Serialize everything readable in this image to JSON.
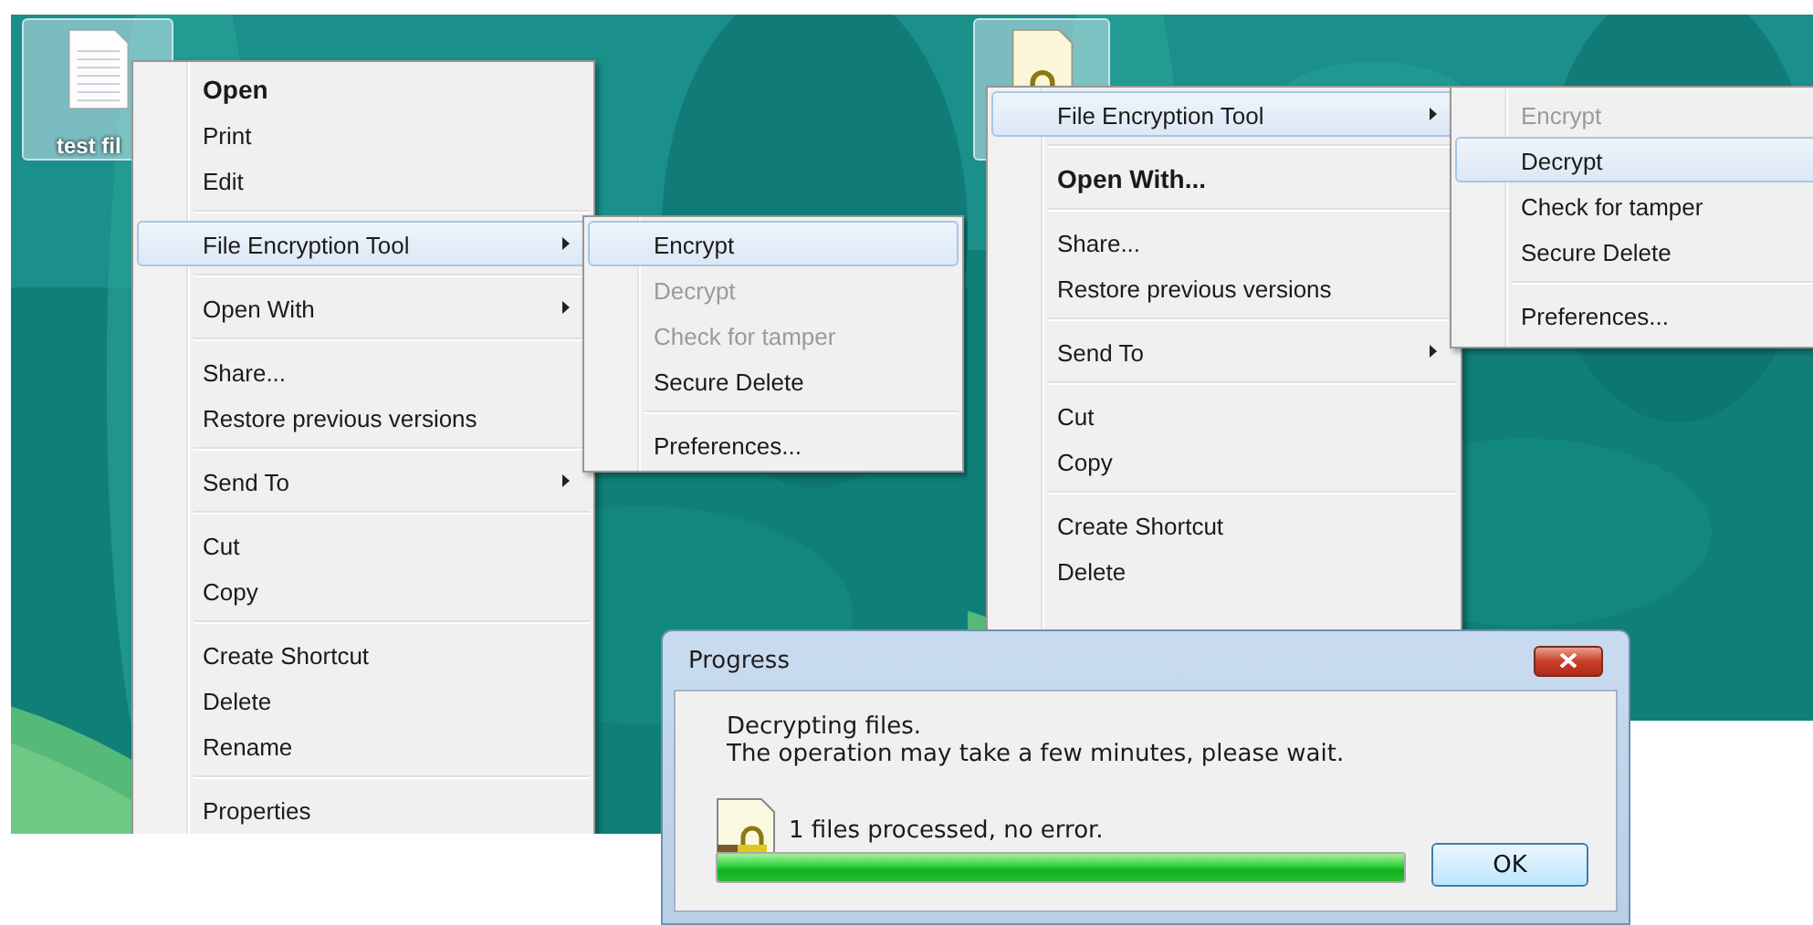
{
  "panels": [
    {
      "icon": {
        "kind": "document",
        "label": "test fil"
      },
      "menu": {
        "items": [
          {
            "kind": "item",
            "label": "Open",
            "bold": true,
            "selected": false,
            "disabled": false,
            "has_submenu": false
          },
          {
            "kind": "item",
            "label": "Print",
            "bold": false,
            "selected": false,
            "disabled": false,
            "has_submenu": false
          },
          {
            "kind": "item",
            "label": "Edit",
            "bold": false,
            "selected": false,
            "disabled": false,
            "has_submenu": false
          },
          {
            "kind": "separator"
          },
          {
            "kind": "item",
            "label": "File Encryption Tool",
            "bold": false,
            "selected": true,
            "disabled": false,
            "has_submenu": true
          },
          {
            "kind": "separator"
          },
          {
            "kind": "item",
            "label": "Open With",
            "bold": false,
            "selected": false,
            "disabled": false,
            "has_submenu": true
          },
          {
            "kind": "separator"
          },
          {
            "kind": "item",
            "label": "Share...",
            "bold": false,
            "selected": false,
            "disabled": false,
            "has_submenu": false
          },
          {
            "kind": "item",
            "label": "Restore previous versions",
            "bold": false,
            "selected": false,
            "disabled": false,
            "has_submenu": false
          },
          {
            "kind": "separator"
          },
          {
            "kind": "item",
            "label": "Send To",
            "bold": false,
            "selected": false,
            "disabled": false,
            "has_submenu": true
          },
          {
            "kind": "separator"
          },
          {
            "kind": "item",
            "label": "Cut",
            "bold": false,
            "selected": false,
            "disabled": false,
            "has_submenu": false
          },
          {
            "kind": "item",
            "label": "Copy",
            "bold": false,
            "selected": false,
            "disabled": false,
            "has_submenu": false
          },
          {
            "kind": "separator"
          },
          {
            "kind": "item",
            "label": "Create Shortcut",
            "bold": false,
            "selected": false,
            "disabled": false,
            "has_submenu": false
          },
          {
            "kind": "item",
            "label": "Delete",
            "bold": false,
            "selected": false,
            "disabled": false,
            "has_submenu": false
          },
          {
            "kind": "item",
            "label": "Rename",
            "bold": false,
            "selected": false,
            "disabled": false,
            "has_submenu": false
          },
          {
            "kind": "separator"
          },
          {
            "kind": "item",
            "label": "Properties",
            "bold": false,
            "selected": false,
            "disabled": false,
            "has_submenu": false
          }
        ]
      },
      "submenu": {
        "items": [
          {
            "kind": "item",
            "label": "Encrypt",
            "bold": false,
            "selected": true,
            "disabled": false,
            "has_submenu": false
          },
          {
            "kind": "item",
            "label": "Decrypt",
            "bold": false,
            "selected": false,
            "disabled": true,
            "has_submenu": false
          },
          {
            "kind": "item",
            "label": "Check for tamper",
            "bold": false,
            "selected": false,
            "disabled": true,
            "has_submenu": false
          },
          {
            "kind": "item",
            "label": "Secure Delete",
            "bold": false,
            "selected": false,
            "disabled": false,
            "has_submenu": false
          },
          {
            "kind": "separator"
          },
          {
            "kind": "item",
            "label": "Preferences...",
            "bold": false,
            "selected": false,
            "disabled": false,
            "has_submenu": false
          }
        ]
      }
    },
    {
      "icon": {
        "kind": "encrypted-document"
      },
      "menu": {
        "items": [
          {
            "kind": "item",
            "label": "File Encryption Tool",
            "bold": false,
            "selected": true,
            "disabled": false,
            "has_submenu": true
          },
          {
            "kind": "separator"
          },
          {
            "kind": "item",
            "label": "Open With...",
            "bold": true,
            "selected": false,
            "disabled": false,
            "has_submenu": false
          },
          {
            "kind": "separator"
          },
          {
            "kind": "item",
            "label": "Share...",
            "bold": false,
            "selected": false,
            "disabled": false,
            "has_submenu": false
          },
          {
            "kind": "item",
            "label": "Restore previous versions",
            "bold": false,
            "selected": false,
            "disabled": false,
            "has_submenu": false
          },
          {
            "kind": "separator"
          },
          {
            "kind": "item",
            "label": "Send To",
            "bold": false,
            "selected": false,
            "disabled": false,
            "has_submenu": true
          },
          {
            "kind": "separator"
          },
          {
            "kind": "item",
            "label": "Cut",
            "bold": false,
            "selected": false,
            "disabled": false,
            "has_submenu": false
          },
          {
            "kind": "item",
            "label": "Copy",
            "bold": false,
            "selected": false,
            "disabled": false,
            "has_submenu": false
          },
          {
            "kind": "separator"
          },
          {
            "kind": "item",
            "label": "Create Shortcut",
            "bold": false,
            "selected": false,
            "disabled": false,
            "has_submenu": false
          },
          {
            "kind": "item",
            "label": "Delete",
            "bold": false,
            "selected": false,
            "disabled": false,
            "has_submenu": false
          }
        ]
      },
      "submenu": {
        "items": [
          {
            "kind": "item",
            "label": "Encrypt",
            "bold": false,
            "selected": false,
            "disabled": true,
            "has_submenu": false
          },
          {
            "kind": "item",
            "label": "Decrypt",
            "bold": false,
            "selected": true,
            "disabled": false,
            "has_submenu": false
          },
          {
            "kind": "item",
            "label": "Check for tamper",
            "bold": false,
            "selected": false,
            "disabled": false,
            "has_submenu": false
          },
          {
            "kind": "item",
            "label": "Secure Delete",
            "bold": false,
            "selected": false,
            "disabled": false,
            "has_submenu": false
          },
          {
            "kind": "separator"
          },
          {
            "kind": "item",
            "label": "Preferences...",
            "bold": false,
            "selected": false,
            "disabled": false,
            "has_submenu": false
          }
        ]
      }
    }
  ],
  "dialog": {
    "title": "Progress",
    "message": [
      "Decrypting files.",
      "The operation may take a few minutes, please wait."
    ],
    "status": "1 files processed, no error.",
    "progress": {
      "level": 1
    },
    "button": "OK"
  }
}
